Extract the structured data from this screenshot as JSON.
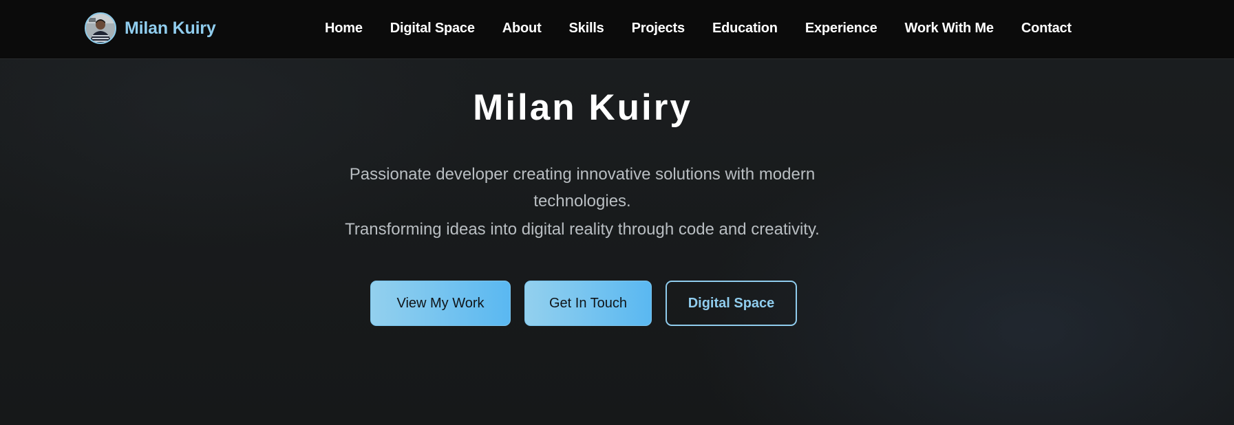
{
  "brand": {
    "name": "Milan Kuiry"
  },
  "nav": {
    "items": [
      {
        "label": "Home"
      },
      {
        "label": "Digital Space"
      },
      {
        "label": "About"
      },
      {
        "label": "Skills"
      },
      {
        "label": "Projects"
      },
      {
        "label": "Education"
      },
      {
        "label": "Experience"
      },
      {
        "label": "Work With Me"
      },
      {
        "label": "Contact"
      }
    ]
  },
  "hero": {
    "title": "Milan Kuiry",
    "subtitle": "Passionate developer creating innovative solutions with modern technologies.",
    "tagline": "Transforming ideas into digital reality through code and creativity.",
    "buttons": {
      "view_work": "View My Work",
      "get_in_touch": "Get In Touch",
      "digital_space": "Digital Space"
    }
  },
  "colors": {
    "accent": "#90cdee",
    "button_gradient_start": "#93d0ee",
    "button_gradient_end": "#5ab8f1",
    "navbar_bg": "#0b0b0b",
    "page_bg": "#17191b"
  }
}
